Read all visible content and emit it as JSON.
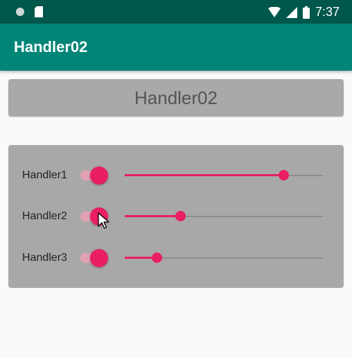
{
  "status_bar": {
    "time": "7:37",
    "icons": [
      "circle-icon",
      "sd-card-icon",
      "wifi-icon",
      "signal-icon",
      "battery-icon"
    ]
  },
  "app_bar": {
    "title": "Handler02"
  },
  "header_button": {
    "label": "Handler02"
  },
  "handlers": [
    {
      "label": "Handler1",
      "switch_on": true,
      "progress": 0.8
    },
    {
      "label": "Handler2",
      "switch_on": true,
      "progress": 0.28
    },
    {
      "label": "Handler3",
      "switch_on": true,
      "progress": 0.16
    }
  ],
  "colors": {
    "status_bar": "#00574b",
    "app_bar": "#008577",
    "accent": "#e91e63",
    "panel": "#a8a8a8"
  }
}
